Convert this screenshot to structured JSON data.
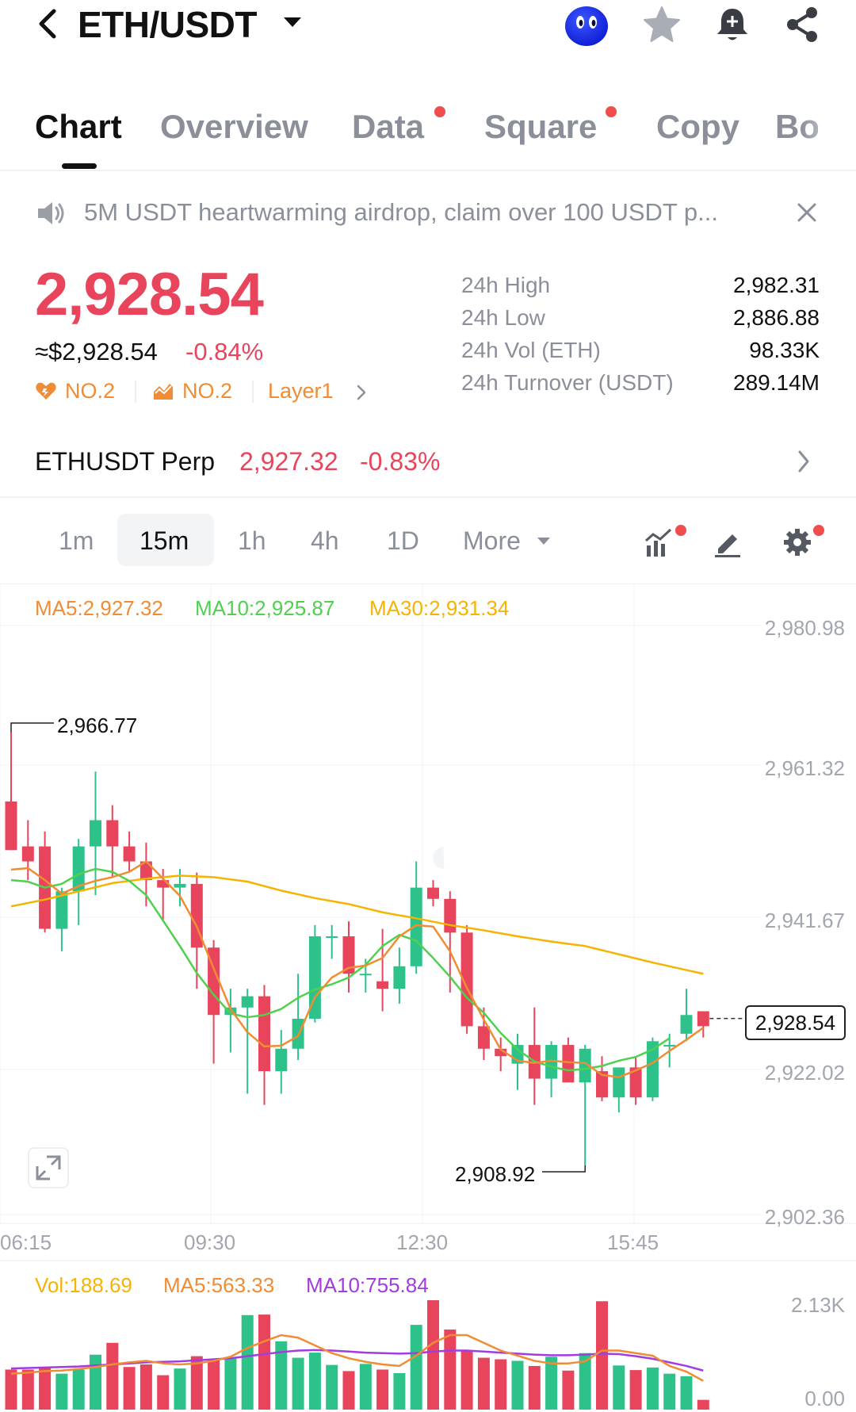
{
  "header": {
    "pair": "ETH/USDT",
    "icons": [
      "back-icon",
      "mascot-avatar",
      "star-icon",
      "bell-plus-icon",
      "share-icon"
    ]
  },
  "tabs": [
    {
      "label": "Chart",
      "active": true,
      "dot": false
    },
    {
      "label": "Overview",
      "active": false,
      "dot": false
    },
    {
      "label": "Data",
      "active": false,
      "dot": true
    },
    {
      "label": "Square",
      "active": false,
      "dot": true
    },
    {
      "label": "Copy",
      "active": false,
      "dot": false
    },
    {
      "label": "Bo",
      "active": false,
      "dot": false
    }
  ],
  "announcement": {
    "icon": "speaker-icon",
    "text": "5M USDT heartwarming airdrop, claim over 100 USDT p...",
    "close_icon": "close-icon"
  },
  "price": {
    "last": "2,928.54",
    "fiat": "≈$2,928.54",
    "change": "-0.84%",
    "tags": [
      {
        "icon": "heart-flame-icon",
        "label": "NO.2"
      },
      {
        "icon": "trending-icon",
        "label": "NO.2"
      },
      {
        "icon": "",
        "label": "Layer1"
      }
    ]
  },
  "stats": [
    {
      "label": "24h High",
      "value": "2,982.31"
    },
    {
      "label": "24h Low",
      "value": "2,886.88"
    },
    {
      "label": "24h Vol (ETH)",
      "value": "98.33K"
    },
    {
      "label": "24h Turnover (USDT)",
      "value": "289.14M"
    }
  ],
  "perp": {
    "label": "ETHUSDT Perp",
    "price": "2,927.32",
    "change": "-0.83%"
  },
  "timeframes": {
    "items": [
      "1m",
      "15m",
      "1h",
      "4h",
      "1D",
      "More"
    ],
    "active": "15m",
    "tools": [
      "indicator-icon",
      "draw-pen-icon",
      "settings-gear-icon"
    ]
  },
  "colors": {
    "down": "#e8455c",
    "up": "#2ec28b",
    "ma5": "#f08c34",
    "ma10": "#4fd14f",
    "ma30": "#f5b400",
    "vol_ma10": "#a23ce0",
    "accent_orange": "#f08c34"
  },
  "chart_data": {
    "type": "candlestick",
    "interval": "15m",
    "legend": {
      "ma5": "MA5:2,927.32",
      "ma10": "MA10:2,925.87",
      "ma30": "MA30:2,931.34"
    },
    "y_ticks": [
      "2,980.98",
      "2,961.32",
      "2,941.67",
      "2,922.02",
      "2,902.36"
    ],
    "y_range": [
      2902.36,
      2980.98
    ],
    "x_ticks": [
      "06:15",
      "09:30",
      "12:30",
      "15:45"
    ],
    "high_marker": "2,966.77",
    "low_marker": "2,908.92",
    "last_price": "2,928.54",
    "candles": [
      {
        "o": 2957.5,
        "h": 2966.8,
        "l": 2951.0,
        "c": 2951.0
      },
      {
        "o": 2951.5,
        "h": 2955.0,
        "l": 2947.0,
        "c": 2949.5
      },
      {
        "o": 2951.5,
        "h": 2953.5,
        "l": 2940.0,
        "c": 2940.5
      },
      {
        "o": 2940.5,
        "h": 2946.0,
        "l": 2937.5,
        "c": 2945.5
      },
      {
        "o": 2945.5,
        "h": 2952.5,
        "l": 2941.0,
        "c": 2951.5
      },
      {
        "o": 2951.5,
        "h": 2961.5,
        "l": 2945.0,
        "c": 2955.0
      },
      {
        "o": 2955.0,
        "h": 2957.0,
        "l": 2947.5,
        "c": 2951.5
      },
      {
        "o": 2951.5,
        "h": 2953.5,
        "l": 2948.0,
        "c": 2949.5
      },
      {
        "o": 2949.5,
        "h": 2952.0,
        "l": 2943.5,
        "c": 2947.0
      },
      {
        "o": 2947.0,
        "h": 2948.5,
        "l": 2941.5,
        "c": 2946.0
      },
      {
        "o": 2946.0,
        "h": 2948.5,
        "l": 2943.5,
        "c": 2946.5
      },
      {
        "o": 2946.5,
        "h": 2948.0,
        "l": 2932.5,
        "c": 2938.0
      },
      {
        "o": 2938.0,
        "h": 2939.0,
        "l": 2922.5,
        "c": 2929.0
      },
      {
        "o": 2929.0,
        "h": 2932.5,
        "l": 2924.0,
        "c": 2930.0
      },
      {
        "o": 2930.0,
        "h": 2932.5,
        "l": 2918.5,
        "c": 2931.5
      },
      {
        "o": 2931.5,
        "h": 2933.0,
        "l": 2917.0,
        "c": 2921.5
      },
      {
        "o": 2921.5,
        "h": 2927.0,
        "l": 2918.5,
        "c": 2924.5
      },
      {
        "o": 2924.5,
        "h": 2934.5,
        "l": 2923.0,
        "c": 2928.5
      },
      {
        "o": 2928.5,
        "h": 2941.0,
        "l": 2928.0,
        "c": 2939.5
      },
      {
        "o": 2939.5,
        "h": 2941.0,
        "l": 2936.5,
        "c": 2939.5
      },
      {
        "o": 2939.5,
        "h": 2941.5,
        "l": 2932.0,
        "c": 2934.5
      },
      {
        "o": 2934.5,
        "h": 2936.5,
        "l": 2932.0,
        "c": 2934.5
      },
      {
        "o": 2933.5,
        "h": 2940.5,
        "l": 2929.5,
        "c": 2932.5
      },
      {
        "o": 2932.5,
        "h": 2938.0,
        "l": 2930.5,
        "c": 2935.5
      },
      {
        "o": 2935.5,
        "h": 2949.5,
        "l": 2934.5,
        "c": 2946.0
      },
      {
        "o": 2946.0,
        "h": 2947.0,
        "l": 2943.5,
        "c": 2944.5
      },
      {
        "o": 2944.5,
        "h": 2945.5,
        "l": 2932.0,
        "c": 2940.0
      },
      {
        "o": 2940.0,
        "h": 2941.0,
        "l": 2926.5,
        "c": 2927.5
      },
      {
        "o": 2927.5,
        "h": 2930.0,
        "l": 2923.0,
        "c": 2924.5
      },
      {
        "o": 2924.5,
        "h": 2926.0,
        "l": 2921.5,
        "c": 2923.5
      },
      {
        "o": 2922.5,
        "h": 2926.5,
        "l": 2919.0,
        "c": 2925.0
      },
      {
        "o": 2925.0,
        "h": 2930.0,
        "l": 2917.0,
        "c": 2920.5
      },
      {
        "o": 2920.5,
        "h": 2925.5,
        "l": 2918.0,
        "c": 2925.0
      },
      {
        "o": 2925.0,
        "h": 2926.0,
        "l": 2920.0,
        "c": 2920.0
      },
      {
        "o": 2920.0,
        "h": 2925.0,
        "l": 2908.9,
        "c": 2924.5
      },
      {
        "o": 2921.5,
        "h": 2923.5,
        "l": 2917.5,
        "c": 2918.0
      },
      {
        "o": 2918.0,
        "h": 2922.0,
        "l": 2916.0,
        "c": 2922.0
      },
      {
        "o": 2922.0,
        "h": 2923.5,
        "l": 2917.0,
        "c": 2918.0
      },
      {
        "o": 2918.0,
        "h": 2926.0,
        "l": 2917.5,
        "c": 2925.5
      },
      {
        "o": 2925.0,
        "h": 2926.5,
        "l": 2922.0,
        "c": 2925.0
      },
      {
        "o": 2926.5,
        "h": 2932.5,
        "l": 2925.5,
        "c": 2929.0
      },
      {
        "o": 2929.5,
        "h": 2929.5,
        "l": 2926.0,
        "c": 2927.5
      }
    ],
    "ma5_series": [
      2948.4,
      2948.6,
      2947.0,
      2945.2,
      2946.2,
      2946.9,
      2947.4,
      2948.1,
      2949.5,
      2947.2,
      2944.9,
      2940.8,
      2935.2,
      2929.8,
      2926.7,
      2924.8,
      2924.9,
      2926.2,
      2931.4,
      2934.0,
      2935.3,
      2935.6,
      2936.6,
      2939.5,
      2941.0,
      2940.8,
      2937.5,
      2932.6,
      2928.4,
      2924.4,
      2922.9,
      2922.6,
      2922.9,
      2922.7,
      2922.6,
      2921.0,
      2920.7,
      2921.6,
      2922.6,
      2924.2,
      2925.7,
      2927.3
    ],
    "ma10_series": [
      2947.0,
      2946.8,
      2946.0,
      2946.5,
      2947.8,
      2948.5,
      2948.1,
      2946.9,
      2945.0,
      2941.6,
      2938.2,
      2934.6,
      2931.7,
      2929.2,
      2928.7,
      2929.0,
      2929.8,
      2931.3,
      2932.4,
      2933.1,
      2934.0,
      2935.7,
      2938.2,
      2939.7,
      2938.9,
      2936.6,
      2934.1,
      2931.3,
      2929.3,
      2926.6,
      2924.4,
      2922.8,
      2922.1,
      2921.6,
      2921.8,
      2922.2,
      2922.9,
      2923.4,
      2924.4,
      2925.9
    ],
    "ma30_series": [
      2943.5,
      2944.4,
      2945.5,
      2946.6,
      2947.2,
      2947.6,
      2947.4,
      2946.8,
      2945.6,
      2944.6,
      2943.8,
      2942.7,
      2941.9,
      2941.0,
      2940.3,
      2939.5,
      2938.8,
      2938.2,
      2937.1,
      2936.0,
      2935.0,
      2934.0,
      2933.0,
      2932.2,
      2931.6,
      2931.3
    ],
    "volume": {
      "legend": {
        "vol": "Vol:188.69",
        "ma5": "MA5:563.33",
        "ma10": "MA10:755.84"
      },
      "y_ticks": [
        "2.13K",
        "0.00"
      ],
      "y_range": [
        0,
        2130
      ],
      "bars": [
        780,
        780,
        820,
        700,
        780,
        1070,
        1300,
        830,
        880,
        670,
        800,
        1040,
        970,
        1010,
        1840,
        1850,
        1330,
        1010,
        1110,
        870,
        750,
        890,
        780,
        710,
        1650,
        2130,
        1560,
        1160,
        1010,
        980,
        950,
        850,
        1030,
        760,
        1100,
        2110,
        860,
        770,
        820,
        700,
        650,
        190
      ],
      "ma5": [
        700,
        720,
        750,
        760,
        790,
        830,
        880,
        920,
        950,
        900,
        880,
        900,
        950,
        1030,
        1200,
        1330,
        1450,
        1400,
        1250,
        1100,
        1000,
        930,
        880,
        850,
        1050,
        1300,
        1450,
        1450,
        1300,
        1150,
        1050,
        950,
        900,
        900,
        940,
        1150,
        1150,
        1100,
        1050,
        850,
        740,
        560
      ],
      "ma10": [
        800,
        810,
        820,
        830,
        840,
        860,
        880,
        900,
        920,
        930,
        940,
        960,
        980,
        1000,
        1040,
        1080,
        1120,
        1150,
        1160,
        1150,
        1130,
        1110,
        1100,
        1090,
        1100,
        1130,
        1150,
        1150,
        1130,
        1110,
        1090,
        1070,
        1060,
        1060,
        1070,
        1090,
        1080,
        1040,
        990,
        920,
        850,
        760
      ]
    }
  }
}
